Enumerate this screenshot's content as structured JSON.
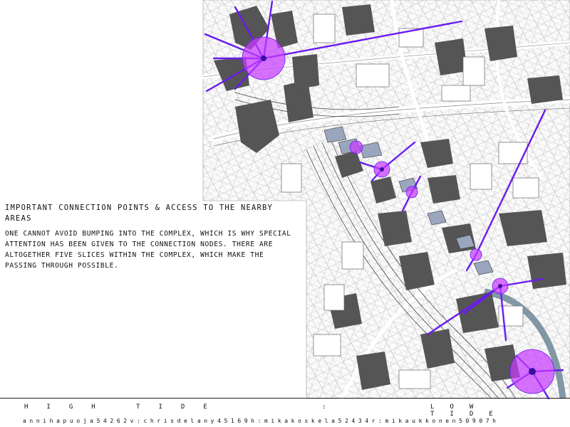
{
  "caption": {
    "heading": "Important connection points & access to the nearby areas",
    "body": "One cannot avoid bumping into the complex, which is why special attention has been given to the connection nodes. There are altogether five slices within the complex, which make the passing through possible."
  },
  "footer": {
    "left": "High tide",
    "separator": ":",
    "right": "Low tide",
    "credits": "annihapuoja54262v:chrisdelany45169h:mikakoskela52434r:mikaukkonen50907h"
  },
  "colors": {
    "access_line": "#6a1bf0",
    "node_fill": "#c83cff",
    "building_shade": "#555555",
    "river": "#6d8796"
  },
  "map": {
    "node_count": 8,
    "icons": [
      "connection-node",
      "access-ray",
      "railway",
      "river"
    ]
  }
}
